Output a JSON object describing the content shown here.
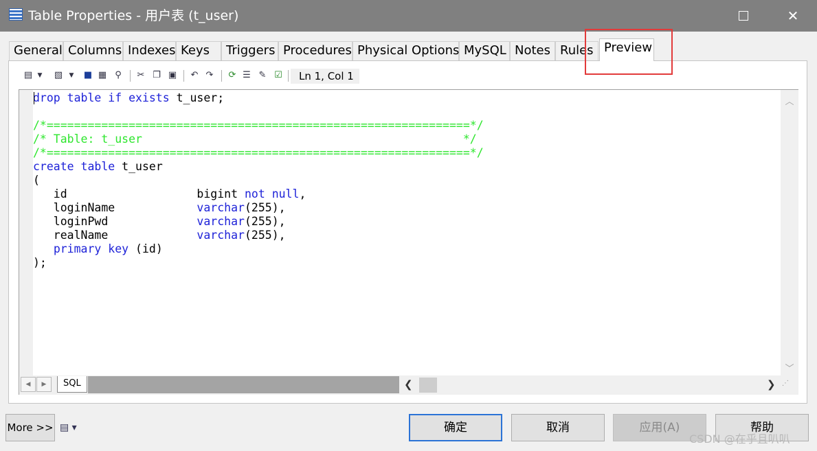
{
  "window": {
    "title": "Table Properties - 用户表 (t_user)",
    "icon": "table-icon",
    "maximize_icon": "maximize-icon",
    "close_label": "✕"
  },
  "tabs": [
    {
      "label": "General",
      "active": false
    },
    {
      "label": "Columns",
      "active": false
    },
    {
      "label": "Indexes",
      "active": false
    },
    {
      "label": "Keys",
      "active": false
    },
    {
      "label": "Triggers",
      "active": false
    },
    {
      "label": "Procedures",
      "active": false
    },
    {
      "label": "Physical Options",
      "active": false
    },
    {
      "label": "MySQL",
      "active": false
    },
    {
      "label": "Notes",
      "active": false
    },
    {
      "label": "Rules",
      "active": false
    },
    {
      "label": "Preview",
      "active": true
    }
  ],
  "toolbar": {
    "icons": [
      "document-menu-icon",
      "edit-menu-icon",
      "save-icon",
      "print-icon",
      "find-icon",
      "cut-icon",
      "copy-icon",
      "paste-icon",
      "undo-icon",
      "redo-icon",
      "refresh-icon",
      "list-icon",
      "edit-icon",
      "check-icon"
    ],
    "position": "Ln 1, Col 1"
  },
  "editor": {
    "language_tab": "SQL",
    "code": [
      [
        {
          "t": "kw",
          "v": "drop table if exists"
        },
        {
          "t": "tx",
          "v": " t_user;"
        }
      ],
      [],
      [
        {
          "t": "cm",
          "v": "/*==============================================================*/"
        }
      ],
      [
        {
          "t": "cm",
          "v": "/* Table: t_user                                               */"
        }
      ],
      [
        {
          "t": "cm",
          "v": "/*==============================================================*/"
        }
      ],
      [
        {
          "t": "kw",
          "v": "create table"
        },
        {
          "t": "tx",
          "v": " t_user"
        }
      ],
      [
        {
          "t": "tx",
          "v": "("
        }
      ],
      [
        {
          "t": "tx",
          "v": "   id                   bigint "
        },
        {
          "t": "kw",
          "v": "not null"
        },
        {
          "t": "tx",
          "v": ","
        }
      ],
      [
        {
          "t": "tx",
          "v": "   loginName            "
        },
        {
          "t": "kw",
          "v": "varchar"
        },
        {
          "t": "tx",
          "v": "(255),"
        }
      ],
      [
        {
          "t": "tx",
          "v": "   loginPwd             "
        },
        {
          "t": "kw",
          "v": "varchar"
        },
        {
          "t": "tx",
          "v": "(255),"
        }
      ],
      [
        {
          "t": "tx",
          "v": "   realName             "
        },
        {
          "t": "kw",
          "v": "varchar"
        },
        {
          "t": "tx",
          "v": "(255),"
        }
      ],
      [
        {
          "t": "tx",
          "v": "   "
        },
        {
          "t": "kw",
          "v": "primary key"
        },
        {
          "t": "tx",
          "v": " (id)"
        }
      ],
      [
        {
          "t": "tx",
          "v": ");"
        }
      ]
    ]
  },
  "footer": {
    "more_label": "More >>",
    "ok_label": "确定",
    "cancel_label": "取消",
    "apply_label": "应用(A)",
    "help_label": "帮助"
  },
  "watermark": "CSDN @在乎且叭叭",
  "colors": {
    "keyword": "#1e22d8",
    "comment": "#2ee62e",
    "highlight": "#e23a3a",
    "default_button": "#2b73d6"
  }
}
